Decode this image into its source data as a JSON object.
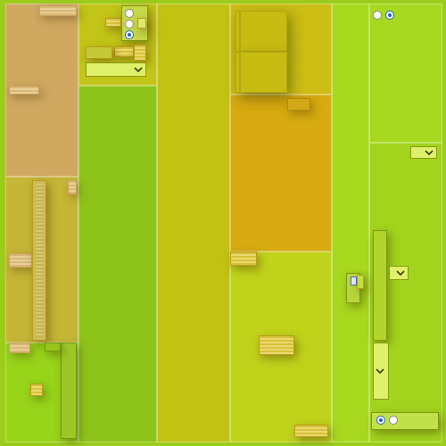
{
  "colors": {
    "lime": "#9ccc1c",
    "green": "#8ac61a",
    "olive": "#c0c414",
    "mustard": "#d6aa10",
    "tan": "#d0a860",
    "pale_lime": "#b2dc2c",
    "select_fill": "#dff06a",
    "radio_selected": "#1e62d8"
  },
  "radios": {
    "top_group": [
      true,
      false,
      false
    ],
    "top_right_pair": [
      false,
      true
    ],
    "bottom_right_pair": [
      true,
      false
    ]
  },
  "icons": {
    "select_chevron": "chevron-down-icon"
  }
}
